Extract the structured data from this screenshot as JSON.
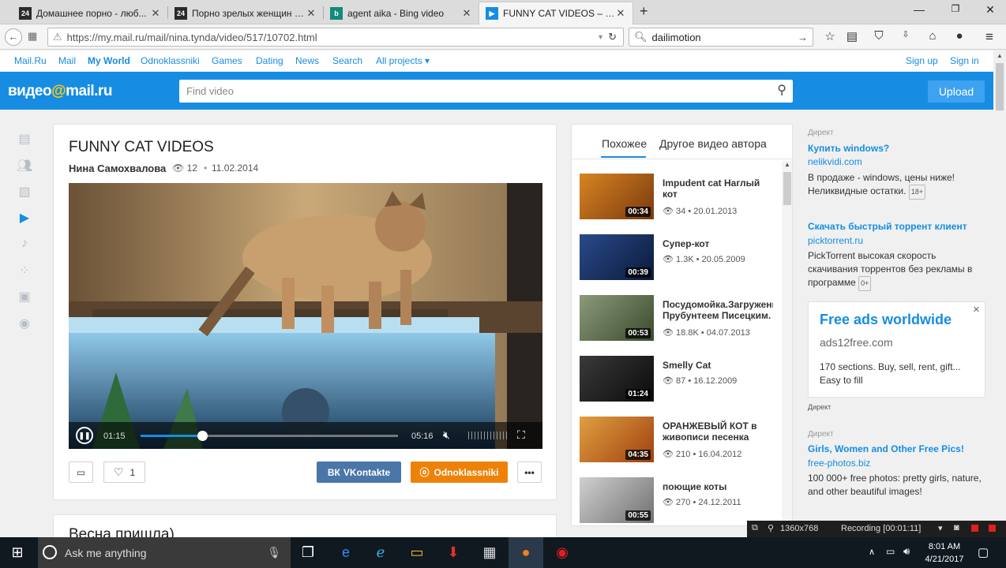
{
  "browser": {
    "tabs": [
      {
        "title": "Домашнее порно - люб...",
        "favicon": "24",
        "fav_color": "#2b2b2b"
      },
      {
        "title": "Порно зрелых женщин б...",
        "favicon": "24",
        "fav_color": "#2b2b2b"
      },
      {
        "title": "agent aika - Bing video",
        "favicon": "b",
        "fav_color": "#138a7e"
      },
      {
        "title": "FUNNY CAT VIDEOS – Wa...",
        "favicon": "▶",
        "fav_color": "#168de2"
      }
    ],
    "url": "https://my.mail.ru/mail/nina.tynda/video/517/10702.html",
    "search_value": "dailimotion"
  },
  "top_links": {
    "items": [
      "Mail.Ru",
      "Mail",
      "My World",
      "Odnoklassniki",
      "Games",
      "Dating",
      "News",
      "Search",
      "All projects ▾"
    ],
    "sign_up": "Sign up",
    "sign_in": "Sign in"
  },
  "header": {
    "logo_left": "видео",
    "logo_at": "@",
    "logo_right": "mail.ru",
    "search_placeholder": "Find video",
    "upload_label": "Upload",
    "accent": "#168de2"
  },
  "video": {
    "title": "FUNNY CAT VIDEOS",
    "author": "Нина Самохвалова",
    "views": "12",
    "date": "11.02.2014",
    "current_time": "01:15",
    "duration": "05:16",
    "progress": 0.24,
    "likes": "1",
    "share_vk": "VKontakte",
    "share_ok": "Odnoklassniki",
    "vk_color": "#4a76a8",
    "ok_color": "#ee8208"
  },
  "next_card": {
    "title": "Весна пришла)"
  },
  "related": {
    "tabs": [
      "Похожее",
      "Другое видео автора"
    ],
    "items": [
      {
        "title": "Impudent cat Наглый кот",
        "views": "34",
        "date": "20.01.2013",
        "duration": "00:34"
      },
      {
        "title": "Супер-кот",
        "views": "1.3K",
        "date": "20.05.2009",
        "duration": "00:39"
      },
      {
        "title": "Посудомойка.Загруженное Прубунтеем Писецким.",
        "views": "18.8K",
        "date": "04.07.2013",
        "duration": "00:53"
      },
      {
        "title": "Smelly Cat",
        "views": "87",
        "date": "16.12.2009",
        "duration": "01:24"
      },
      {
        "title": "ОРАНЖЕВЫЙ КОТ в живописи песенка",
        "views": "210",
        "date": "16.04.2012",
        "duration": "04:35"
      },
      {
        "title": "поющие коты",
        "views": "270",
        "date": "24.12.2011",
        "duration": "00:55"
      }
    ]
  },
  "ads": {
    "label": "Директ",
    "ad1": {
      "title": "Купить windows?",
      "url": "nelikvidi.com",
      "text": "В продаже - windows, цены ниже! Неликвидные остатки.",
      "age": "18+"
    },
    "ad2": {
      "title": "Скачать быстрый торрент клиент",
      "url": "picktorrent.ru",
      "text": "PickTorrent высокая скорость скачивания торрентов без рекламы в программе",
      "age": "0+"
    },
    "box": {
      "title": "Free ads worldwide",
      "url": "ads12free.com",
      "text": "170 sections. Buy, sell, rent, gift... Easy to fill",
      "label": "Директ"
    },
    "ad3": {
      "title": "Girls, Women and Other Free Pics!",
      "url": "free-photos.biz",
      "text": "100 000+ free photos: pretty girls, nature, and other beautiful images!"
    }
  },
  "recorder": {
    "resolution": "1360x768",
    "status": "Recording [00:01:11]"
  },
  "taskbar": {
    "search_placeholder": "Ask me anything",
    "time": "8:01 AM",
    "date": "4/21/2017"
  }
}
